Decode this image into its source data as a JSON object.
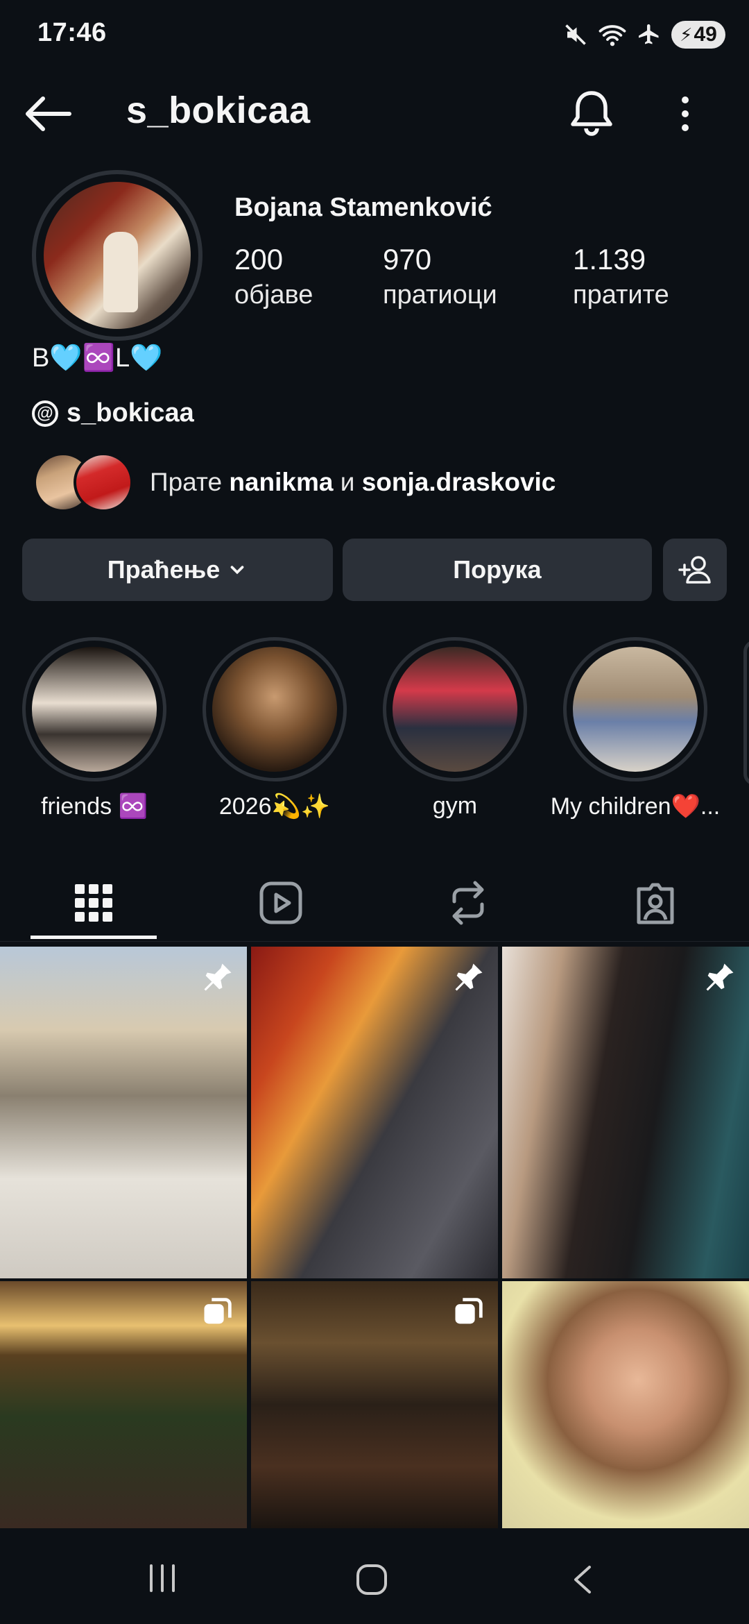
{
  "status_bar": {
    "time": "17:46",
    "battery": "49"
  },
  "header": {
    "username": "s_bokicaa"
  },
  "profile": {
    "display_name": "Bojana Stamenković",
    "stats": [
      {
        "value": "200",
        "label": "објаве"
      },
      {
        "value": "970",
        "label": "пратиоци"
      },
      {
        "value": "1.139",
        "label": "пратите"
      }
    ],
    "bio": "B🩵♾️L🩵",
    "threads_handle": "s_bokicaa",
    "followed_by": {
      "prefix": "Прате",
      "user1": "nanikma",
      "conj": "и",
      "user2": "sonja.draskovic"
    }
  },
  "actions": {
    "follow_label": "Праћење",
    "message_label": "Порука"
  },
  "highlights": [
    {
      "label": "friends ♾️"
    },
    {
      "label": "2026💫✨"
    },
    {
      "label": "gym"
    },
    {
      "label": "My children❤️..."
    }
  ],
  "tabs": [
    "grid",
    "reels",
    "reposts",
    "tagged"
  ],
  "posts": [
    {
      "badge": "pin-icon"
    },
    {
      "badge": "pin-icon"
    },
    {
      "badge": "pin-icon"
    },
    {
      "badge": "carousel-icon"
    },
    {
      "badge": "carousel-icon"
    },
    {
      "badge": ""
    }
  ]
}
